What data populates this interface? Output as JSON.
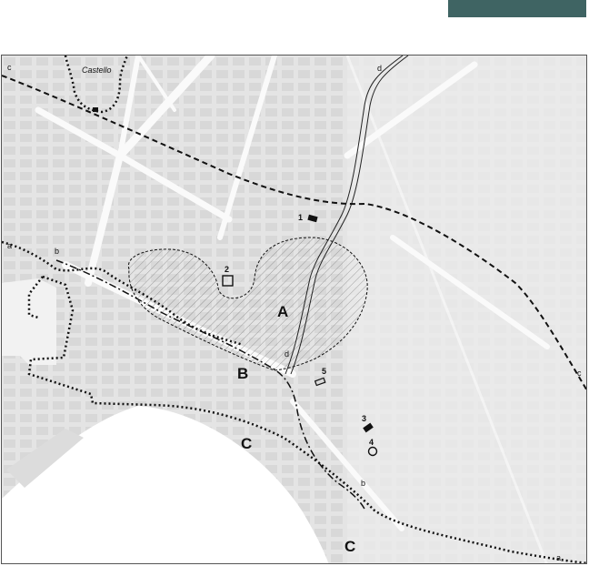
{
  "header": {
    "tab_color": "#3f6463"
  },
  "map": {
    "place_labels": {
      "castello": "Castello"
    },
    "zone_labels": {
      "A": "A",
      "B": "B",
      "C1": "C",
      "C2": "C"
    },
    "line_labels": {
      "a_left": "a",
      "a_right": "a",
      "b_left": "b",
      "b_right": "b",
      "c_left": "c",
      "c_right": "c",
      "d_top": "d",
      "d_mid": "d"
    },
    "site_labels": {
      "s1": "1",
      "s2": "2",
      "s3": "3",
      "s4": "4",
      "s5": "5"
    },
    "colors": {
      "land": "#e6e6e6",
      "water": "#ffffff",
      "roads": "#fbfbfb",
      "boundary": "#111111"
    }
  }
}
